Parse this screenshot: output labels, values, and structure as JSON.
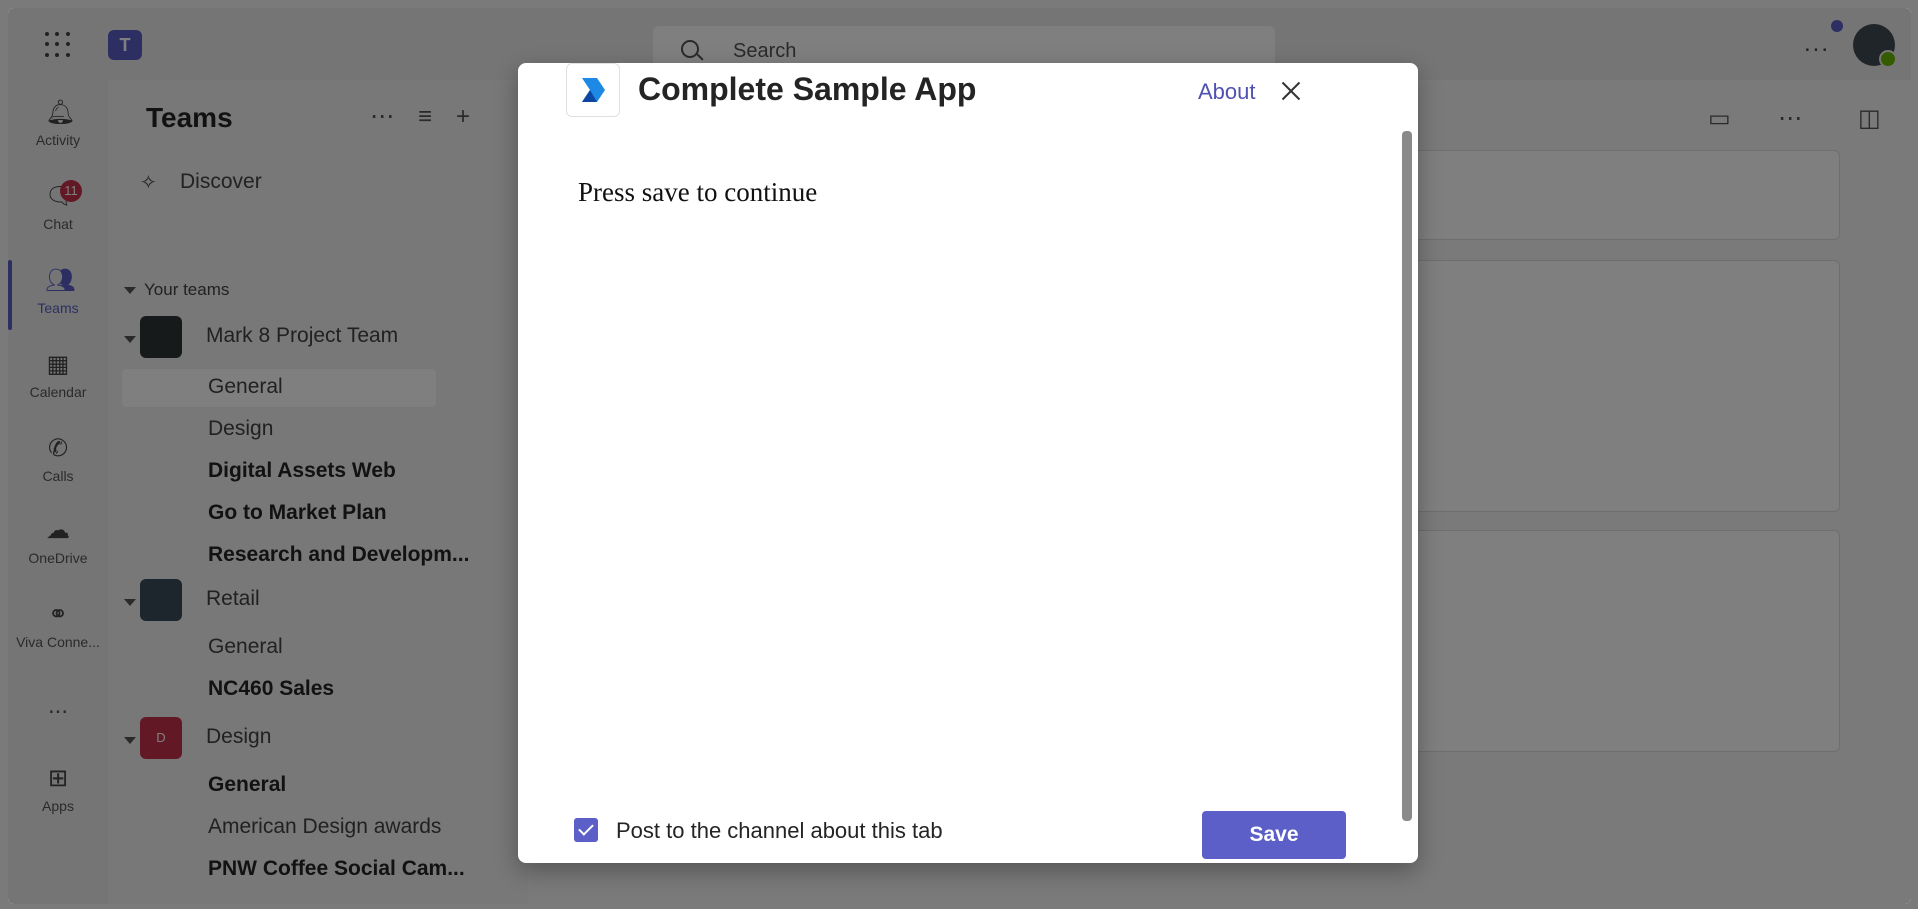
{
  "topbar": {
    "search_placeholder": "Search",
    "more_label": "...",
    "logo_letter": "T"
  },
  "rail": {
    "items": [
      {
        "label": "Activity",
        "icon": "bell-icon"
      },
      {
        "label": "Chat",
        "icon": "chat-icon",
        "badge": "11"
      },
      {
        "label": "Teams",
        "icon": "teams-icon"
      },
      {
        "label": "Calendar",
        "icon": "calendar-icon"
      },
      {
        "label": "Calls",
        "icon": "phone-icon"
      },
      {
        "label": "OneDrive",
        "icon": "cloud-icon"
      },
      {
        "label": "Viva Conne...",
        "icon": "viva-icon"
      },
      {
        "label": "...",
        "icon": "more-icon"
      },
      {
        "label": "Apps",
        "icon": "apps-icon"
      }
    ]
  },
  "pane": {
    "title": "Teams",
    "discover": "Discover",
    "section": "Your teams",
    "teams": [
      {
        "name": "Mark 8 Project Team",
        "channels": [
          {
            "name": "General",
            "bold": false
          },
          {
            "name": "Design",
            "bold": false
          },
          {
            "name": "Digital Assets Web",
            "bold": true
          },
          {
            "name": "Go to Market Plan",
            "bold": true
          },
          {
            "name": "Research and Developm...",
            "bold": true
          }
        ]
      },
      {
        "name": "Retail",
        "channels": [
          {
            "name": "General",
            "bold": false
          },
          {
            "name": "NC460 Sales",
            "bold": true
          }
        ]
      },
      {
        "name": "Design",
        "avatar_letter": "D",
        "channels": [
          {
            "name": "General",
            "bold": true
          },
          {
            "name": "American Design awards",
            "bold": false
          },
          {
            "name": "PNW Coffee Social Cam...",
            "bold": true
          }
        ]
      }
    ]
  },
  "dialog": {
    "title": "Complete Sample App",
    "about": "About",
    "content": "Press save to continue",
    "checkbox_label": "Post to the channel about this tab",
    "checkbox_checked": true,
    "save_label": "Save"
  },
  "colors": {
    "accent": "#5b5fc7",
    "badge": "#c4314b"
  }
}
